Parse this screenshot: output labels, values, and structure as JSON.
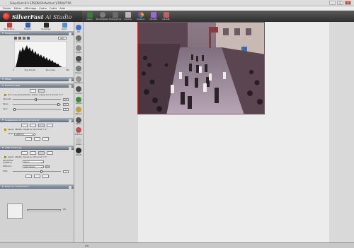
{
  "window": {
    "title": "SilverFast 8.5 EPSON Perfection V700/V750"
  },
  "menu": [
    "Fichier",
    "Editer",
    "Affichage",
    "Cadre",
    "Outils",
    "Aide"
  ],
  "brand": {
    "name_a": "SilverFast",
    "name_b": "Ai Studio"
  },
  "toolbar": [
    {
      "label": "Aperçu",
      "color": "#3a7d3a"
    },
    {
      "label": "WorkflowPilot",
      "color": "#7d7d7d"
    },
    {
      "label": "Histogramme",
      "color": "#6a6a6a"
    },
    {
      "label": "Courbes",
      "color": "#b8b8b8"
    },
    {
      "label": "Couleurs",
      "color": "#e05a2a"
    },
    {
      "label": "Vignette",
      "color": "#9a6ad0"
    },
    {
      "label": "Densité",
      "color": "#c06060"
    }
  ],
  "modes": [
    {
      "label": "Paramètres",
      "color": "#c04040"
    },
    {
      "label": "Fenêtre",
      "color": "#3a5fa8"
    },
    {
      "label": "Numériser",
      "color": "#2a2a2a"
    },
    {
      "label": "Batch",
      "color": "#5a8fc8"
    }
  ],
  "sections": {
    "histogram": {
      "title": "Histogramme",
      "auto_value": "auto",
      "low": [
        "0",
        "Tons foncés",
        "0"
      ],
      "high": [
        "255",
        "Tons clairs",
        "255"
      ]
    },
    "filters": {
      "title": "Filtres"
    },
    "sharpen": {
      "title": "Netteté (USM)",
      "hint": "Pour une prévisualisation exacte, cliquez sur la touche \"1:1\"",
      "rows": [
        {
          "label": "Intensité",
          "value": "100",
          "pos": 0.46
        },
        {
          "label": "Rayon",
          "value": "0.1",
          "pos": 0.92
        },
        {
          "label": "Seuil",
          "value": "0",
          "pos": 0.02
        }
      ]
    },
    "grain": {
      "title": "Suppression du grain et du bruit",
      "hint": "Aperçu détaillé, cliquez sur la touche \"1:1\"",
      "preset_label": "Profil",
      "preset_value": "GANE film"
    },
    "dust": {
      "title": "iSRD Infrarouge",
      "hint": "Aperçu détaillé, cliquez sur la touche \"1:1\"",
      "mode_label": "Paramètres prédéfinis",
      "mode_value": "Aucun",
      "detect_label": "Détection",
      "detect_value": "Automatique",
      "size_label": "Taille",
      "size_value": "2"
    },
    "output": {
      "title": "Mode de numérisation",
      "progress_pct": "0%"
    }
  },
  "sidetools": [
    {
      "label": "Info",
      "color": "#3a6fd0"
    },
    {
      "label": "Zoom",
      "color": "#6a6a6a"
    },
    {
      "label": "Pipette",
      "color": "#8a8a8a"
    },
    {
      "label": "Profile",
      "color": "#4a4a4a"
    },
    {
      "label": "Niveaux",
      "color": "#7a7a7a"
    },
    {
      "label": "Gradation",
      "color": "#909090"
    },
    {
      "label": "Courbes",
      "color": "#505050"
    },
    {
      "label": "Densité",
      "color": "#3a8a3a"
    },
    {
      "label": "Balance",
      "color": "#c0a030"
    },
    {
      "label": "Neutre",
      "color": "#555555"
    },
    {
      "label": "Multi-Exp.",
      "color": "#c05050"
    },
    {
      "label": "Couleur",
      "color": "#c0c0c0"
    },
    {
      "label": "Négatif",
      "color": "#2a2a2a"
    }
  ],
  "status": {
    "text": "Prêt"
  },
  "colors": {
    "accent": "#c33333",
    "panel": "#d2d2d2",
    "header": "#7a8796"
  }
}
